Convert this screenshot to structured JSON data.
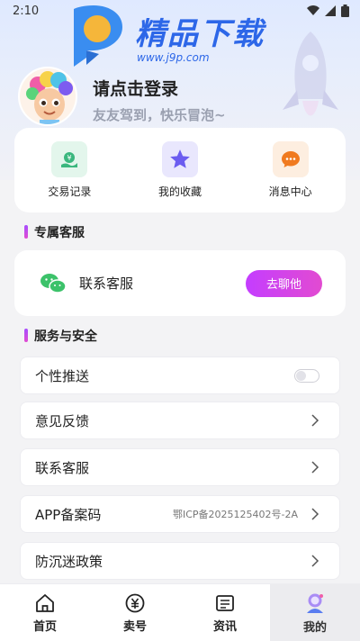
{
  "status_bar": {
    "time": "2:10"
  },
  "watermark": {
    "title": "精品下载",
    "url": "www.j9p.com"
  },
  "profile": {
    "login_title": "请点击登录",
    "subtitle": "友友驾到，快乐冒泡~"
  },
  "quick_actions": [
    {
      "label": "交易记录",
      "icon": "transaction-record-icon",
      "color": "#3bb77e",
      "bg": "#e3f6ec"
    },
    {
      "label": "我的收藏",
      "icon": "star-icon",
      "color": "#6b5cf0",
      "bg": "#e9e7fd"
    },
    {
      "label": "消息中心",
      "icon": "message-icon",
      "color": "#f07a1f",
      "bg": "#fdeee0"
    }
  ],
  "section_exclusive": {
    "title": "专属客服"
  },
  "service": {
    "label": "联系客服",
    "button": "去聊他"
  },
  "section_service": {
    "title": "服务与安全"
  },
  "settings": [
    {
      "label": "个性推送",
      "type": "toggle"
    },
    {
      "label": "意见反馈",
      "type": "arrow"
    },
    {
      "label": "联系客服",
      "type": "arrow"
    },
    {
      "label": "APP备案码",
      "type": "arrow",
      "extra": "鄂ICP备2025125402号-2A"
    },
    {
      "label": "防沉迷政策",
      "type": "arrow"
    }
  ],
  "tabs": [
    {
      "label": "首页",
      "icon": "home-icon"
    },
    {
      "label": "卖号",
      "icon": "sell-icon"
    },
    {
      "label": "资讯",
      "icon": "news-icon"
    },
    {
      "label": "我的",
      "icon": "profile-icon",
      "active": true
    }
  ]
}
